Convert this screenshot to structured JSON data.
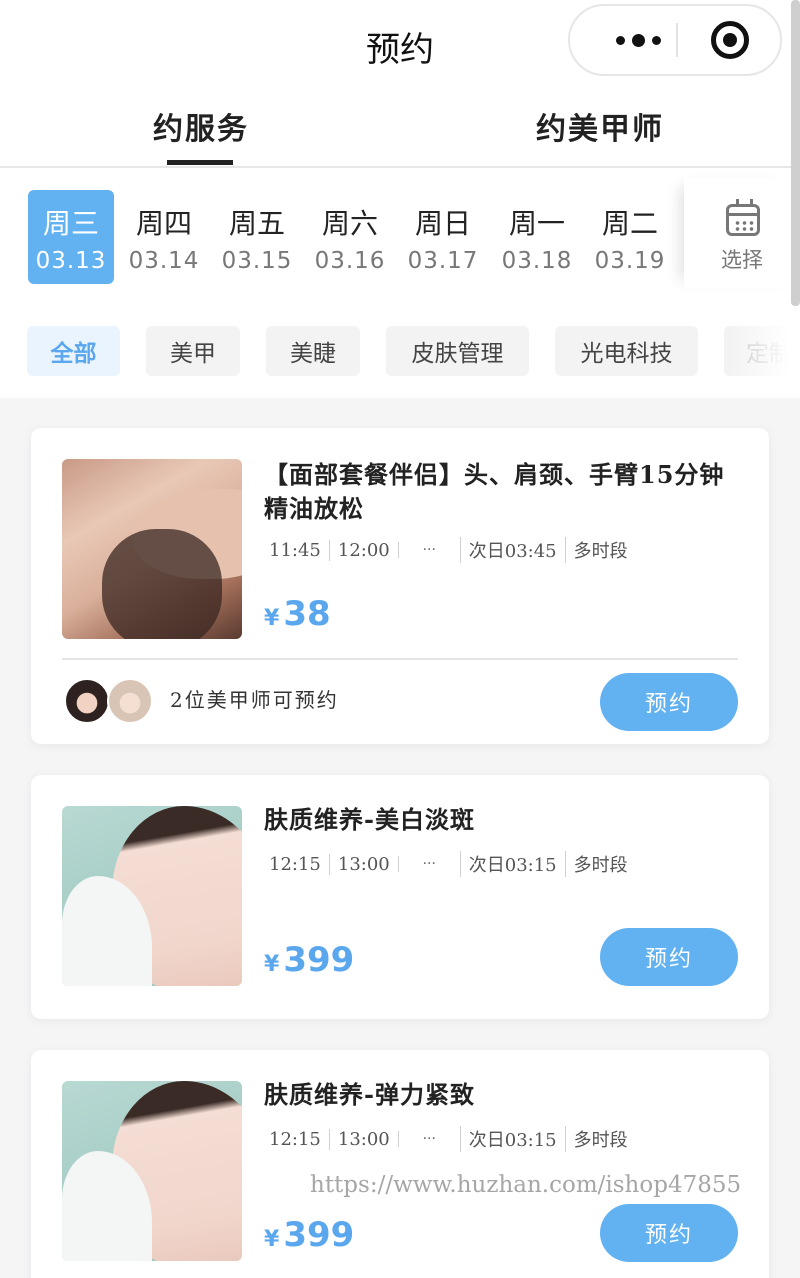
{
  "nav": {
    "title": "预约"
  },
  "tabs": [
    {
      "label": "约服务",
      "active": true
    },
    {
      "label": "约美甲师",
      "active": false
    }
  ],
  "dates": [
    {
      "weekday": "周三",
      "date": "03.13",
      "active": true
    },
    {
      "weekday": "周四",
      "date": "03.14"
    },
    {
      "weekday": "周五",
      "date": "03.15"
    },
    {
      "weekday": "周六",
      "date": "03.16"
    },
    {
      "weekday": "周日",
      "date": "03.17"
    },
    {
      "weekday": "周一",
      "date": "03.18"
    },
    {
      "weekday": "周二",
      "date": "03.19"
    }
  ],
  "date_select": {
    "label": "选择",
    "icon": "calendar-icon"
  },
  "categories": [
    {
      "label": "全部",
      "active": true
    },
    {
      "label": "美甲"
    },
    {
      "label": "美睫"
    },
    {
      "label": "皮肤管理"
    },
    {
      "label": "光电科技"
    },
    {
      "label": "定制"
    }
  ],
  "services": [
    {
      "title": "【面部套餐伴侣】头、肩颈、手臂15分钟精油放松",
      "slots": [
        "11:45",
        "12:00",
        "···",
        "次日03:45",
        "多时段"
      ],
      "currency": "¥",
      "price": "38",
      "book_label": "预约",
      "technician_text": "2位美甲师可预约"
    },
    {
      "title": "肤质维养-美白淡斑",
      "slots": [
        "12:15",
        "13:00",
        "···",
        "次日03:15",
        "多时段"
      ],
      "currency": "¥",
      "price": "399",
      "book_label": "预约"
    },
    {
      "title": "肤质维养-弹力紧致",
      "slots": [
        "12:15",
        "13:00",
        "···",
        "次日03:15",
        "多时段"
      ],
      "currency": "¥",
      "price": "399",
      "book_label": "预约"
    }
  ],
  "watermark": "https://www.huzhan.com/ishop47855",
  "colors": {
    "accent": "#62b1f1",
    "price": "#5aa7ee",
    "chip_active_bg": "#eaf4fe"
  }
}
